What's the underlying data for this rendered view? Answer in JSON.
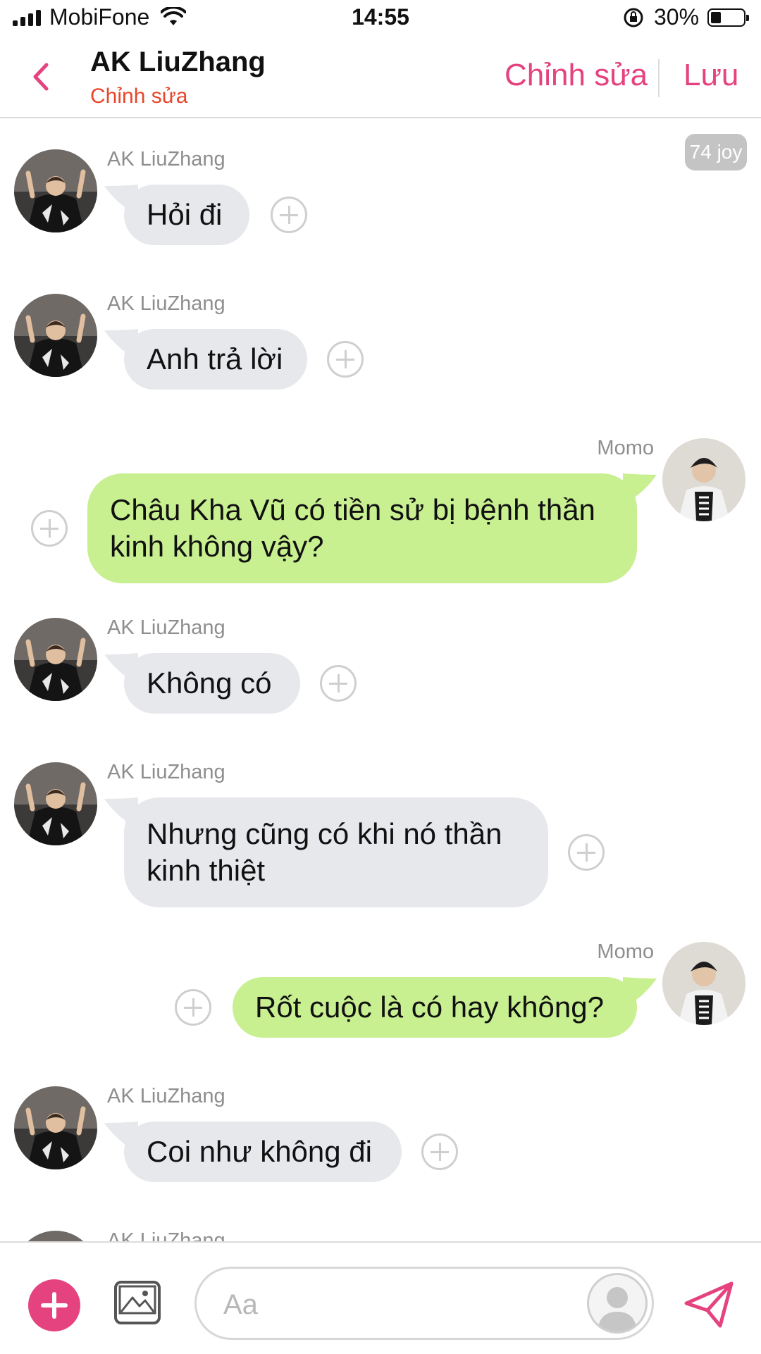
{
  "status_bar": {
    "carrier": "MobiFone",
    "time": "14:55",
    "battery": "30%"
  },
  "header": {
    "title": "AK LiuZhang",
    "subtitle": "Chỉnh sửa",
    "edit_label": "Chỉnh sửa",
    "save_label": "Lưu"
  },
  "badge": {
    "text": "74 joy"
  },
  "messages": [
    {
      "sender": "AK LiuZhang",
      "text": "Hỏi đi"
    },
    {
      "sender": "AK LiuZhang",
      "text": "Anh trả lời"
    },
    {
      "sender": "Momo",
      "text": "Châu Kha Vũ có tiền sử bị bệnh thần kinh không vậy?"
    },
    {
      "sender": "AK LiuZhang",
      "text": "Không có"
    },
    {
      "sender": "AK LiuZhang",
      "text": "Nhưng cũng có khi nó thần kinh thiệt"
    },
    {
      "sender": "Momo",
      "text": "Rốt cuộc là có hay không?"
    },
    {
      "sender": "AK LiuZhang",
      "text": "Coi như không đi"
    },
    {
      "sender": "AK LiuZhang",
      "text": ""
    }
  ],
  "composer": {
    "placeholder": "Aa"
  },
  "colors": {
    "accent": "#e5437f",
    "left_bubble": "#e6e8ec",
    "right_bubble": "#c8ef90",
    "subtitle": "#e8452a"
  },
  "icons": [
    "back-chevron-icon",
    "signal-icon",
    "wifi-icon",
    "orientation-lock-icon",
    "battery-icon",
    "add-icon",
    "image-icon",
    "user-avatar-icon",
    "send-icon",
    "add-reaction-icon"
  ]
}
